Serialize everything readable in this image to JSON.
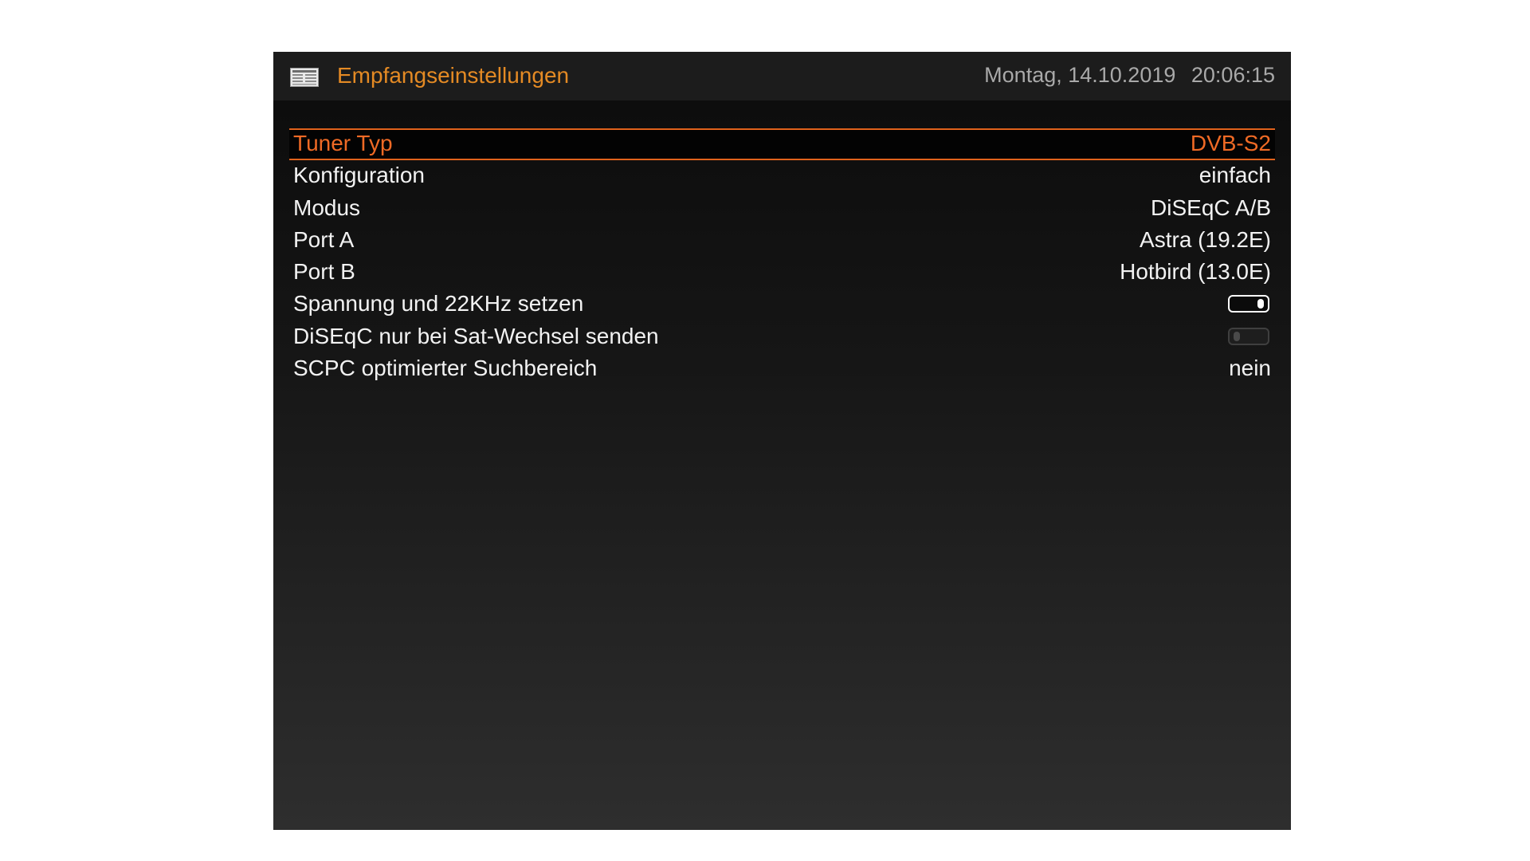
{
  "header": {
    "icon": "settings-card-icon",
    "title": "Empfangseinstellungen",
    "date": "Montag, 14.10.2019",
    "time": "20:06:15"
  },
  "colors": {
    "accent": "#e48a24",
    "selection": "#e0621c",
    "text": "#f2f2f2"
  },
  "settings": [
    {
      "label": "Tuner Typ",
      "value": "DVB-S2",
      "selected": true
    },
    {
      "label": "Konfiguration",
      "value": "einfach"
    },
    {
      "label": "Modus",
      "value": "DiSEqC A/B"
    },
    {
      "label": "Port A",
      "value": "Astra (19.2E)"
    },
    {
      "label": "Port B",
      "value": "Hotbird (13.0E)"
    },
    {
      "label": "Spannung und 22KHz setzen",
      "toggle": true,
      "state": "on"
    },
    {
      "label": "DiSEqC nur bei Sat-Wechsel senden",
      "toggle": true,
      "state": "off"
    },
    {
      "label": "SCPC optimierter Suchbereich",
      "value": "nein"
    }
  ]
}
